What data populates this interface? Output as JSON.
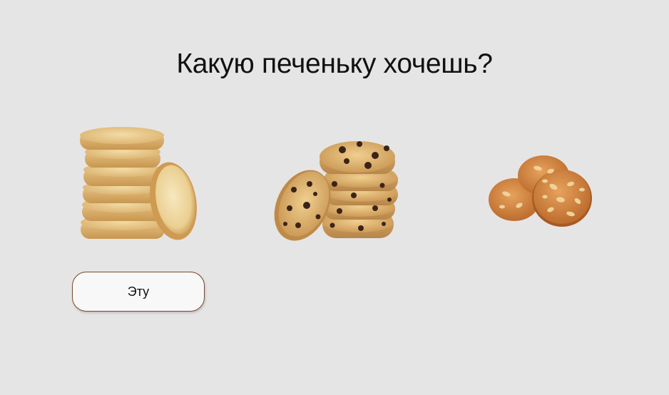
{
  "page": {
    "title": "Какую печеньку хочешь?"
  },
  "cookies": [
    {
      "icon": "shortbread-cookie-stack-icon"
    },
    {
      "icon": "chocolate-chip-cookie-stack-icon"
    },
    {
      "icon": "nut-cookie-icon"
    }
  ],
  "selection": {
    "button_label": "Эту"
  },
  "colors": {
    "background": "#e6e5e5",
    "button_border": "#7a4a30",
    "button_fill": "#f8f8f8",
    "text": "#111111"
  }
}
